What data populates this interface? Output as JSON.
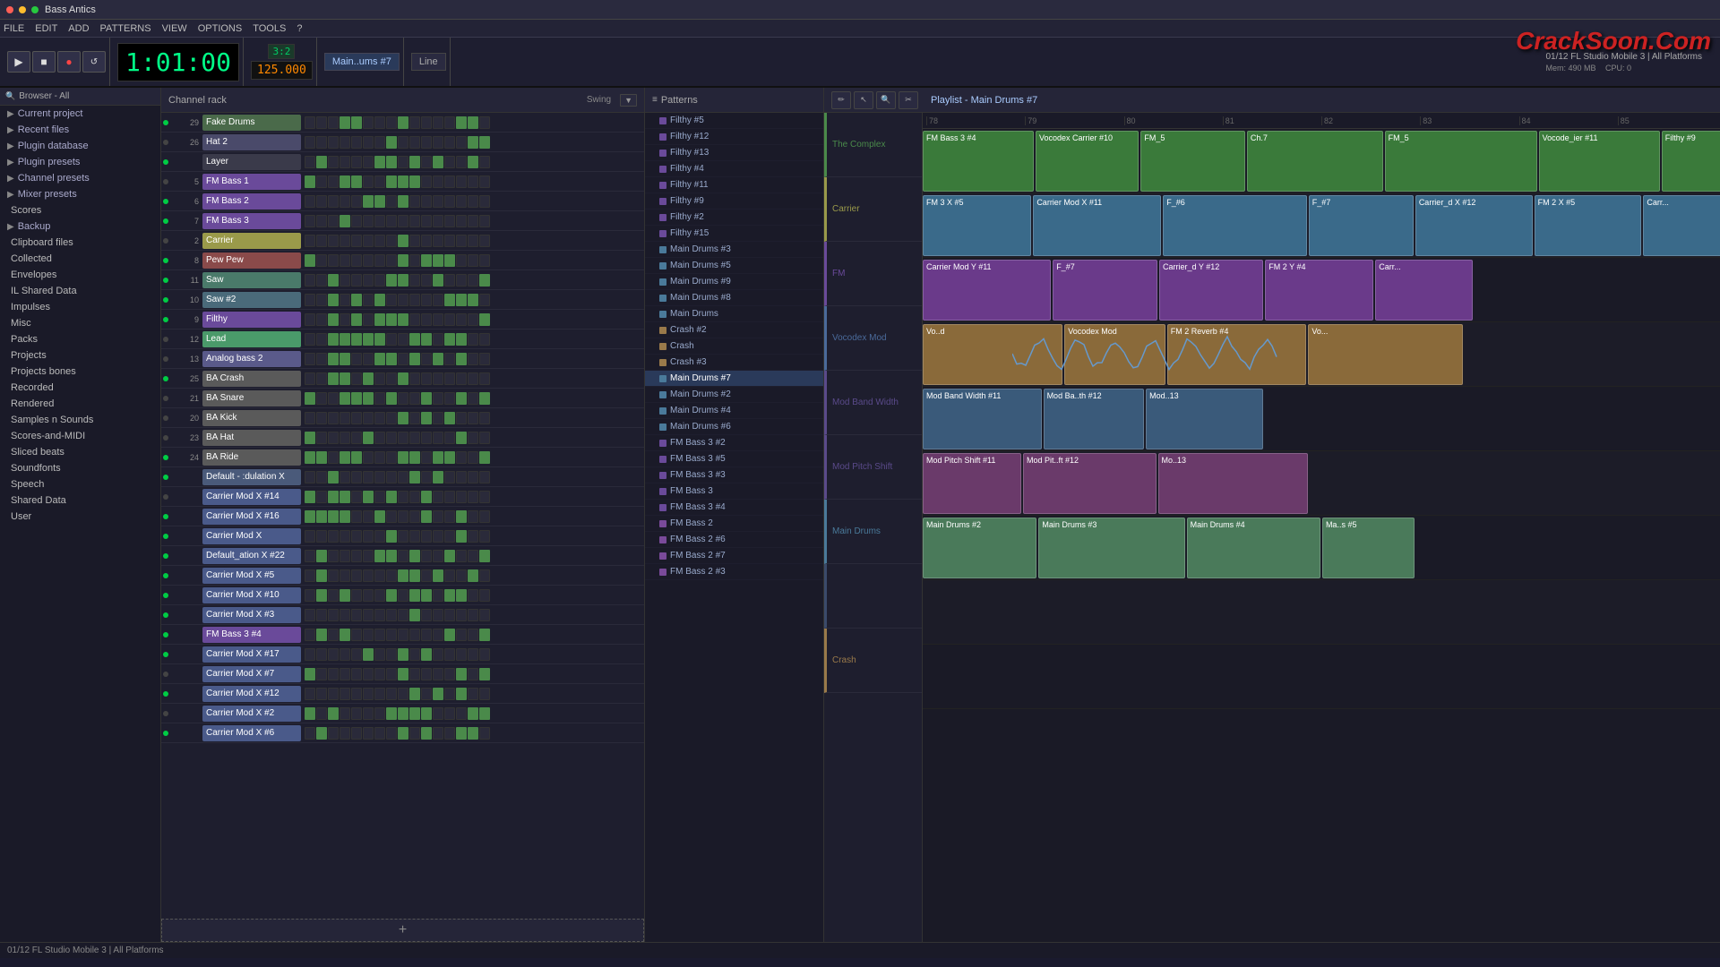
{
  "window": {
    "title": "Bass Antics",
    "close_btn": "×",
    "min_btn": "−",
    "max_btn": "□"
  },
  "menu": {
    "items": [
      "FILE",
      "EDIT",
      "ADD",
      "PATTERNS",
      "VIEW",
      "OPTIONS",
      "TOOLS",
      "?"
    ]
  },
  "toolbar": {
    "tempo": "1:01:00",
    "bpm": "125.000",
    "pattern_label": "3:2",
    "instrument_label": "Main..ums #7",
    "line_label": "Line"
  },
  "browser": {
    "header": "Browser - All",
    "items": [
      {
        "label": "Current project",
        "icon": "▶",
        "type": "folder"
      },
      {
        "label": "Recent files",
        "icon": "▶",
        "type": "folder"
      },
      {
        "label": "Plugin database",
        "icon": "▶",
        "type": "folder"
      },
      {
        "label": "Plugin presets",
        "icon": "▶",
        "type": "folder"
      },
      {
        "label": "Channel presets",
        "icon": "▶",
        "type": "folder"
      },
      {
        "label": "Mixer presets",
        "icon": "▶",
        "type": "folder"
      },
      {
        "label": "Scores",
        "icon": " ",
        "type": "item"
      },
      {
        "label": "Backup",
        "icon": "▶",
        "type": "folder"
      },
      {
        "label": "Clipboard files",
        "icon": " ",
        "type": "item"
      },
      {
        "label": "Collected",
        "icon": " ",
        "type": "item"
      },
      {
        "label": "Envelopes",
        "icon": " ",
        "type": "item"
      },
      {
        "label": "IL Shared Data",
        "icon": " ",
        "type": "item"
      },
      {
        "label": "Impulses",
        "icon": " ",
        "type": "item"
      },
      {
        "label": "Misc",
        "icon": " ",
        "type": "item"
      },
      {
        "label": "Packs",
        "icon": " ",
        "type": "item"
      },
      {
        "label": "Projects",
        "icon": " ",
        "type": "item"
      },
      {
        "label": "Projects bones",
        "icon": " ",
        "type": "item"
      },
      {
        "label": "Recorded",
        "icon": " ",
        "type": "item"
      },
      {
        "label": "Rendered",
        "icon": " ",
        "type": "item"
      },
      {
        "label": "Samples n Sounds",
        "icon": " ",
        "type": "item"
      },
      {
        "label": "Scores-and-MIDI",
        "icon": " ",
        "type": "item"
      },
      {
        "label": "Sliced beats",
        "icon": " ",
        "type": "item"
      },
      {
        "label": "Soundfonts",
        "icon": " ",
        "type": "item"
      },
      {
        "label": "Speech",
        "icon": " ",
        "type": "item"
      },
      {
        "label": "Shared Data",
        "icon": " ",
        "type": "item"
      },
      {
        "label": "User",
        "icon": " ",
        "type": "item"
      }
    ]
  },
  "channel_rack": {
    "title": "Channel rack",
    "swing_label": "Swing",
    "channels": [
      {
        "num": "29",
        "name": "Fake Drums",
        "color": "#4a6a4a"
      },
      {
        "num": "26",
        "name": "Hat 2",
        "color": "#4a4a6a"
      },
      {
        "num": "",
        "name": "Layer",
        "color": "#3a3a4a"
      },
      {
        "num": "5",
        "name": "FM Bass 1",
        "color": "#6a4a9a"
      },
      {
        "num": "6",
        "name": "FM Bass 2",
        "color": "#6a4a9a"
      },
      {
        "num": "7",
        "name": "FM Bass 3",
        "color": "#6a4a9a"
      },
      {
        "num": "2",
        "name": "Carrier",
        "color": "#9a9a4a"
      },
      {
        "num": "8",
        "name": "Pew Pew",
        "color": "#8a4a4a"
      },
      {
        "num": "11",
        "name": "Saw",
        "color": "#4a7a6a"
      },
      {
        "num": "10",
        "name": "Saw #2",
        "color": "#4a6a7a"
      },
      {
        "num": "9",
        "name": "Filthy",
        "color": "#6a4a9a"
      },
      {
        "num": "12",
        "name": "Lead",
        "color": "#4a9a6a"
      },
      {
        "num": "13",
        "name": "Analog bass 2",
        "color": "#5a5a8a"
      },
      {
        "num": "25",
        "name": "BA Crash",
        "color": "#5a5a5a"
      },
      {
        "num": "21",
        "name": "BA Snare",
        "color": "#5a5a5a"
      },
      {
        "num": "20",
        "name": "BA Kick",
        "color": "#5a5a5a"
      },
      {
        "num": "23",
        "name": "BA Hat",
        "color": "#5a5a5a"
      },
      {
        "num": "24",
        "name": "BA Ride",
        "color": "#5a5a5a"
      },
      {
        "num": "",
        "name": "Default - :dulation X",
        "color": "#4a5a7a"
      },
      {
        "num": "",
        "name": "Carrier Mod X #14",
        "color": "#4a5a8a"
      },
      {
        "num": "",
        "name": "Carrier Mod X #16",
        "color": "#4a5a8a"
      },
      {
        "num": "",
        "name": "Carrier Mod X",
        "color": "#4a5a8a"
      },
      {
        "num": "",
        "name": "Default_ation X #22",
        "color": "#4a5a8a"
      },
      {
        "num": "",
        "name": "Carrier Mod X #5",
        "color": "#4a5a8a"
      },
      {
        "num": "",
        "name": "Carrier Mod X #10",
        "color": "#4a5a8a"
      },
      {
        "num": "",
        "name": "Carrier Mod X #3",
        "color": "#4a5a8a"
      },
      {
        "num": "",
        "name": "FM Bass 3 #4",
        "color": "#6a4a9a"
      },
      {
        "num": "",
        "name": "Carrier Mod X #17",
        "color": "#4a5a8a"
      },
      {
        "num": "",
        "name": "Carrier Mod X #7",
        "color": "#4a5a8a"
      },
      {
        "num": "",
        "name": "Carrier Mod X #12",
        "color": "#4a5a8a"
      },
      {
        "num": "",
        "name": "Carrier Mod X #2",
        "color": "#4a5a8a"
      },
      {
        "num": "",
        "name": "Carrier Mod X #6",
        "color": "#4a5a8a"
      }
    ]
  },
  "patterns": {
    "header": "Patterns",
    "items": [
      {
        "label": "Filthy #5",
        "color": "#6a4a9a"
      },
      {
        "label": "Filthy #12",
        "color": "#6a4a9a"
      },
      {
        "label": "Filthy #13",
        "color": "#6a4a9a"
      },
      {
        "label": "Filthy #4",
        "color": "#6a4a9a"
      },
      {
        "label": "Filthy #11",
        "color": "#6a4a9a"
      },
      {
        "label": "Filthy #9",
        "color": "#6a4a9a"
      },
      {
        "label": "Filthy #2",
        "color": "#6a4a9a"
      },
      {
        "label": "Filthy #15",
        "color": "#6a4a9a"
      },
      {
        "label": "Main Drums #3",
        "color": "#4a7a9a"
      },
      {
        "label": "Main Drums #5",
        "color": "#4a7a9a"
      },
      {
        "label": "Main Drums #9",
        "color": "#4a7a9a"
      },
      {
        "label": "Main Drums #8",
        "color": "#4a7a9a"
      },
      {
        "label": "Main Drums",
        "color": "#4a7a9a"
      },
      {
        "label": "Crash #2",
        "color": "#9a7a4a"
      },
      {
        "label": "Crash",
        "color": "#9a7a4a"
      },
      {
        "label": "Crash #3",
        "color": "#9a7a4a"
      },
      {
        "label": "Main Drums #7",
        "color": "#4a7a9a",
        "active": true
      },
      {
        "label": "Main Drums #2",
        "color": "#4a7a9a"
      },
      {
        "label": "Main Drums #4",
        "color": "#4a7a9a"
      },
      {
        "label": "Main Drums #6",
        "color": "#4a7a9a"
      },
      {
        "label": "FM Bass 3 #2",
        "color": "#6a4a9a"
      },
      {
        "label": "FM Bass 3 #5",
        "color": "#6a4a9a"
      },
      {
        "label": "FM Bass 3 #3",
        "color": "#6a4a9a"
      },
      {
        "label": "FM Bass 3",
        "color": "#6a4a9a"
      },
      {
        "label": "FM Bass 3 #4",
        "color": "#6a4a9a"
      },
      {
        "label": "FM Bass 2",
        "color": "#7a4a9a"
      },
      {
        "label": "FM Bass 2 #6",
        "color": "#7a4a9a"
      },
      {
        "label": "FM Bass 2 #7",
        "color": "#7a4a9a"
      },
      {
        "label": "FM Bass 2 #3",
        "color": "#7a4a9a"
      }
    ]
  },
  "playlist": {
    "title": "Playlist - Main Drums #7",
    "tracks": [
      {
        "label": "The Complex",
        "color": "#4a8a4a"
      },
      {
        "label": "Carrier",
        "color": "#9a9a4a"
      },
      {
        "label": "FM",
        "color": "#6a4a9a"
      },
      {
        "label": "Vocodex Mod",
        "color": "#4a6a9a"
      },
      {
        "label": "Mod Band Width",
        "color": "#5a4a8a"
      },
      {
        "label": "Mod Pitch Shift",
        "color": "#5a4a8a"
      },
      {
        "label": "Main Drums",
        "color": "#4a7a9a"
      },
      {
        "label": "",
        "color": "#3a4a6a"
      },
      {
        "label": "Crash",
        "color": "#9a7a4a"
      }
    ]
  },
  "statusbar": {
    "info": "01/12 FL Studio Mobile 3 | All Platforms",
    "mem": "490 MB",
    "cpu": "0"
  },
  "watermark": "CrackSoon.Com"
}
